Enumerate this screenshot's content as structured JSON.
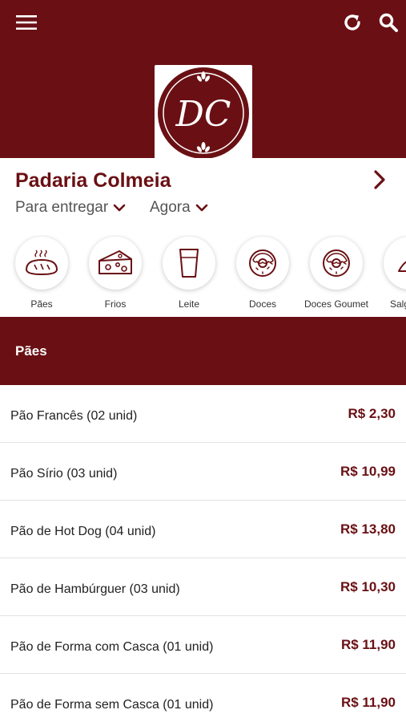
{
  "header": {
    "menu_icon": "hamburger-menu-icon",
    "refresh_icon": "refresh-icon",
    "search_icon": "search-icon",
    "logo_initials": "DC",
    "brand_color": "#6a1014"
  },
  "store": {
    "name": "Padaria Colmeia",
    "delivery_label": "Para entregar",
    "time_label": "Agora"
  },
  "categories": [
    {
      "label": "Pães",
      "icon": "bread-icon"
    },
    {
      "label": "Frios",
      "icon": "cheese-icon"
    },
    {
      "label": "Leite",
      "icon": "milk-glass-icon"
    },
    {
      "label": "Doces",
      "icon": "donut-icon"
    },
    {
      "label": "Doces Goumet",
      "icon": "donut-icon"
    },
    {
      "label": "Salgados",
      "icon": "savory-icon"
    }
  ],
  "section": {
    "title": "Pães"
  },
  "products": [
    {
      "name": "Pão Francês (02 unid)",
      "price": "R$ 2,30"
    },
    {
      "name": "Pão Sírio (03 unid)",
      "price": "R$ 10,99"
    },
    {
      "name": "Pão de Hot Dog (04 unid)",
      "price": "R$ 13,80"
    },
    {
      "name": "Pão de Hambúrguer (03 unid)",
      "price": "R$ 10,30"
    },
    {
      "name": "Pão de Forma com Casca (01 unid)",
      "price": "R$ 11,90"
    },
    {
      "name": "Pão de Forma sem Casca (01 unid)",
      "price": "R$ 11,90"
    }
  ]
}
